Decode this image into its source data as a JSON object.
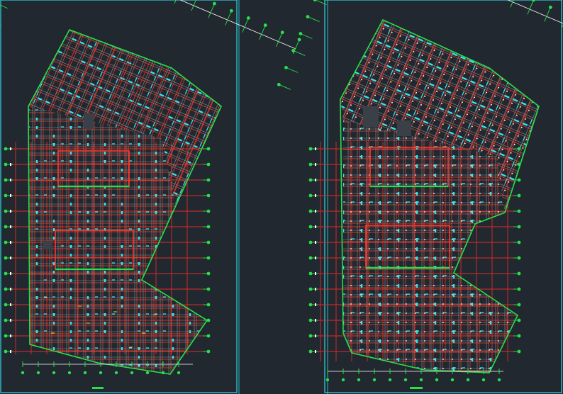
{
  "drawing": {
    "colors": {
      "background": "#212830",
      "frame": "#2fd6e6",
      "axis_grid": "#e12b26",
      "outline": "#27e049",
      "beam_primary": "#33e4ee",
      "beam_secondary": "#8b8f96",
      "column_mark": "#ffffff",
      "annotation_mark": "#f4d43a"
    },
    "sheets": [
      {
        "id": "left-sheet"
      },
      {
        "id": "right-sheet"
      }
    ]
  }
}
